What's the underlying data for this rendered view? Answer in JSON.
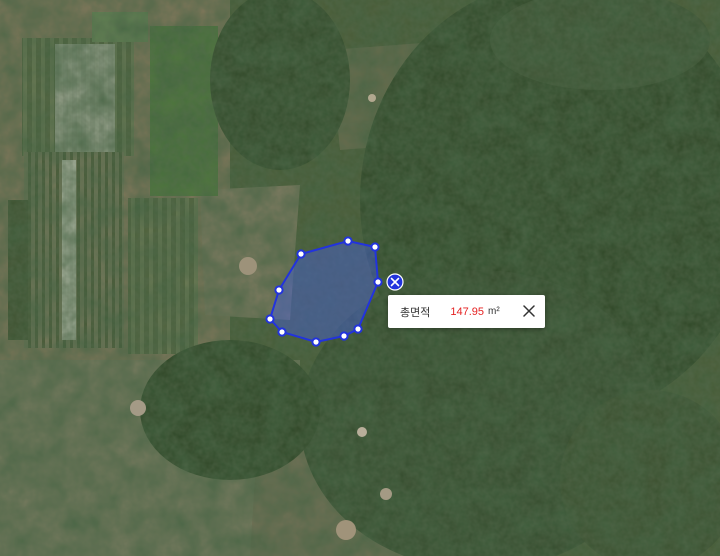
{
  "measurement": {
    "label": "총면적",
    "value": "147.95",
    "unit": "m²",
    "value_color": "#e52222",
    "shape_color": "#2233dd"
  },
  "icons": {
    "delete_measurement": "x-circle-icon",
    "close_popup": "close-icon"
  }
}
